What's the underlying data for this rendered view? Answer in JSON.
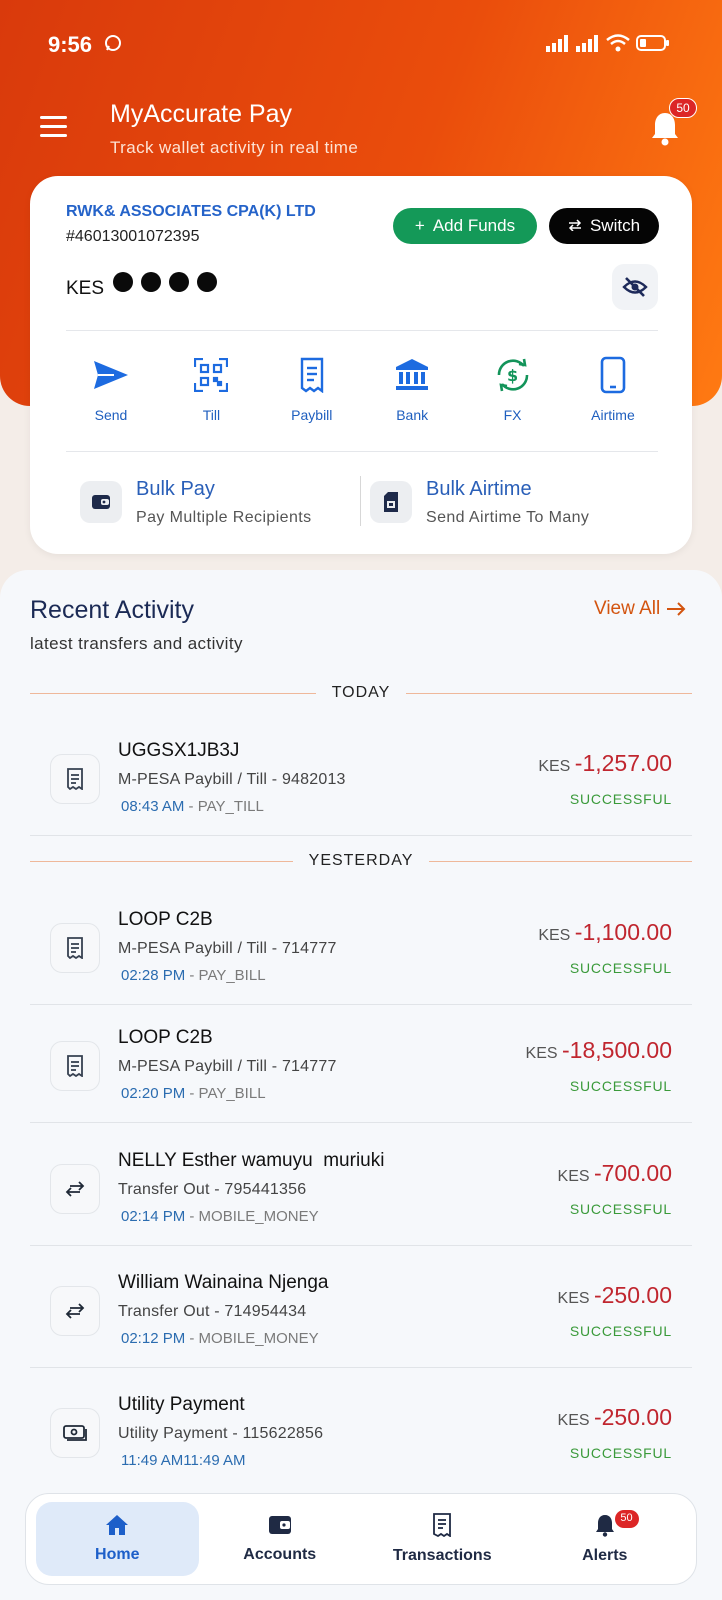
{
  "status_bar": {
    "time": "9:56"
  },
  "header": {
    "title": "MyAccurate Pay",
    "subtitle": "Track wallet activity in real time",
    "notification_count": "50"
  },
  "wallet": {
    "account_name": "RWK& ASSOCIATES CPA(K) LTD",
    "account_number": "#46013001072395",
    "currency": "KES",
    "add_funds_label": "Add Funds",
    "switch_label": "Switch"
  },
  "quick_actions": [
    {
      "label": "Send",
      "icon": "send-icon"
    },
    {
      "label": "Till",
      "icon": "qr-code-icon"
    },
    {
      "label": "Paybill",
      "icon": "receipt-icon"
    },
    {
      "label": "Bank",
      "icon": "bank-icon"
    },
    {
      "label": "FX",
      "icon": "currency-exchange-icon"
    },
    {
      "label": "Airtime",
      "icon": "phone-icon"
    }
  ],
  "bulk": {
    "pay_title": "Bulk Pay",
    "pay_sub": "Pay Multiple Recipients",
    "airtime_title": "Bulk Airtime",
    "airtime_sub": "Send Airtime To Many"
  },
  "recent_activity": {
    "title": "Recent Activity",
    "subtitle": "latest transfers and activity",
    "view_all": "View All",
    "groups": {
      "today": "TODAY",
      "yesterday": "YESTERDAY"
    },
    "transactions": [
      {
        "title": "UGGSX1JB3J",
        "desc": "M-PESA Paybill / Till - 9482013",
        "time": "08:43 AM",
        "type": " - PAY_TILL",
        "currency": "KES ",
        "amount": "-1,257.00",
        "status": "SUCCESSFUL",
        "icon": "receipt-icon"
      },
      {
        "title": "LOOP C2B",
        "desc": "M-PESA Paybill / Till - 714777",
        "time": "02:28 PM",
        "type": " - PAY_BILL",
        "currency": "KES ",
        "amount": "-1,100.00",
        "status": "SUCCESSFUL",
        "icon": "receipt-icon"
      },
      {
        "title": "LOOP C2B",
        "desc": "M-PESA Paybill / Till - 714777",
        "time": "02:20 PM",
        "type": " - PAY_BILL",
        "currency": "KES ",
        "amount": "-18,500.00",
        "status": "SUCCESSFUL",
        "icon": "receipt-icon"
      },
      {
        "title": "NELLY Esther wamuyu  muriuki",
        "desc": "Transfer Out - 795441356",
        "time": "02:14 PM",
        "type": " - MOBILE_MONEY",
        "currency": "KES ",
        "amount": "-700.00",
        "status": "SUCCESSFUL",
        "icon": "transfer-arrows-icon"
      },
      {
        "title": "William Wainaina Njenga",
        "desc": "Transfer Out - 714954434",
        "time": "02:12 PM",
        "type": " - MOBILE_MONEY",
        "currency": "KES ",
        "amount": "-250.00",
        "status": "SUCCESSFUL",
        "icon": "transfer-arrows-icon"
      },
      {
        "title": "Utility Payment",
        "desc": "Utility Payment - 115622856",
        "time": "11:49 AM",
        "type": "11:49 AM",
        "currency": "KES ",
        "amount": "-250.00",
        "status": "SUCCESSFUL",
        "icon": "utility-bill-icon"
      }
    ]
  },
  "bottom_nav": {
    "home": "Home",
    "accounts": "Accounts",
    "transactions": "Transactions",
    "alerts": "Alerts",
    "alerts_badge": "50"
  },
  "colors": {
    "brand_orange": "#e8480c",
    "accent_blue": "#1d5fc9",
    "success_green": "#149958",
    "debit_red": "#c0262f"
  }
}
